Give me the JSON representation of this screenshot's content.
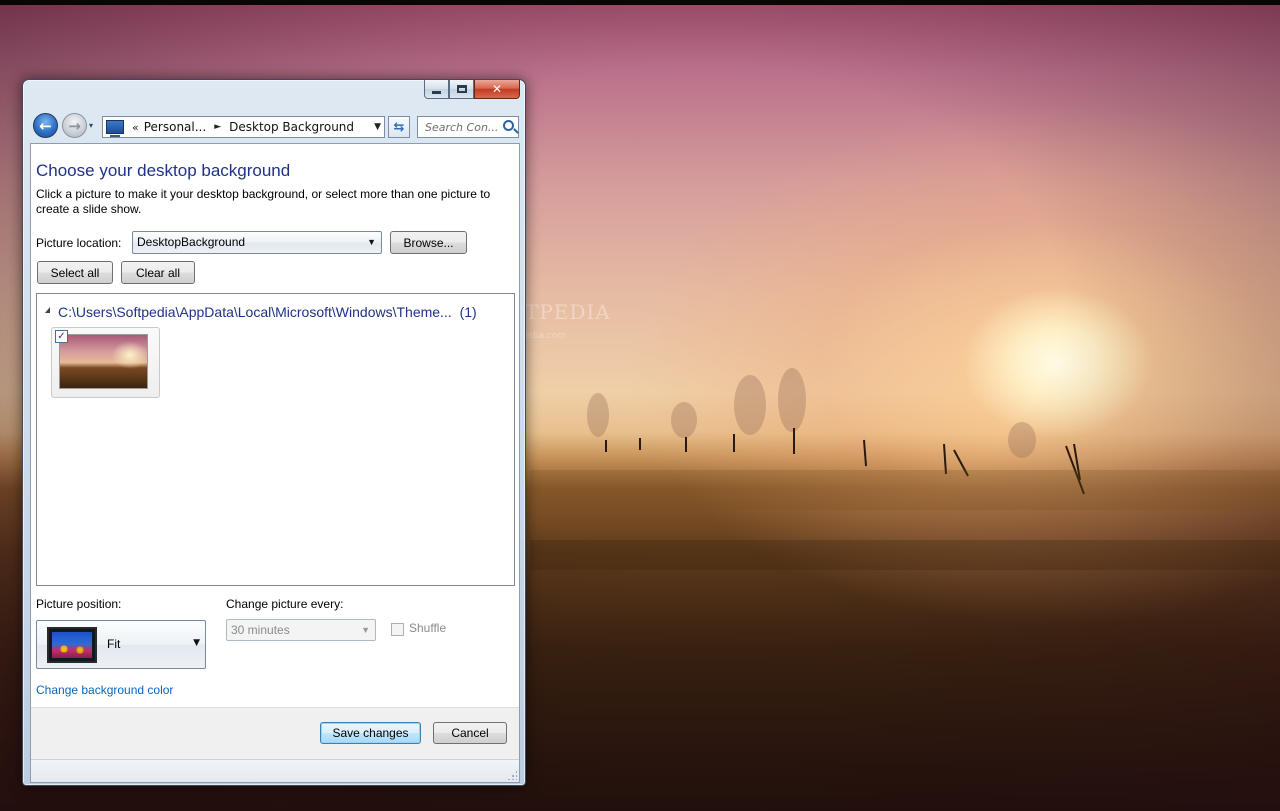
{
  "desktop": {
    "watermark": "SOFTPEDIA",
    "watermark_sub": "www.softpedia.com"
  },
  "window": {
    "caption_buttons": {
      "minimize_icon": "minimize-icon",
      "maximize_icon": "maximize-icon",
      "close_glyph": "✕"
    },
    "navbar": {
      "back_glyph": "←",
      "forward_glyph": "→",
      "recent_glyph": "▾",
      "address": {
        "overflow": "«",
        "crumb_parent": "Personal...",
        "separator": "►",
        "crumb_current": "Desktop Background",
        "dropdown_glyph": "▼"
      },
      "refresh_glyph": "⇆",
      "search_placeholder": "Search Con..."
    }
  },
  "content": {
    "title": "Choose your desktop background",
    "description": "Click a picture to make it your desktop background, or select more than one picture to create a slide show.",
    "picture_location": {
      "label": "Picture location:",
      "value": "DesktopBackground",
      "dropdown_glyph": "▼"
    },
    "browse_label": "Browse...",
    "select_all_label": "Select all",
    "clear_all_label": "Clear all",
    "picture_group": {
      "path": "C:\\Users\\Softpedia\\AppData\\Local\\Microsoft\\Windows\\Theme...",
      "count": "(1)",
      "items": [
        {
          "checked": true,
          "check_glyph": "✓"
        }
      ]
    },
    "picture_position": {
      "label": "Picture position:",
      "value": "Fit",
      "dropdown_glyph": "▼"
    },
    "change_picture": {
      "label": "Change picture every:",
      "value": "30 minutes",
      "dropdown_glyph": "▼",
      "enabled": false
    },
    "shuffle": {
      "label": "Shuffle",
      "checked": false,
      "enabled": false
    },
    "change_bg_color_link": "Change background color",
    "save_label": "Save changes",
    "cancel_label": "Cancel"
  },
  "colors": {
    "title_blue": "#1e3287",
    "link_blue": "#0c63b9",
    "disabled_text": "#8a8a8a"
  }
}
